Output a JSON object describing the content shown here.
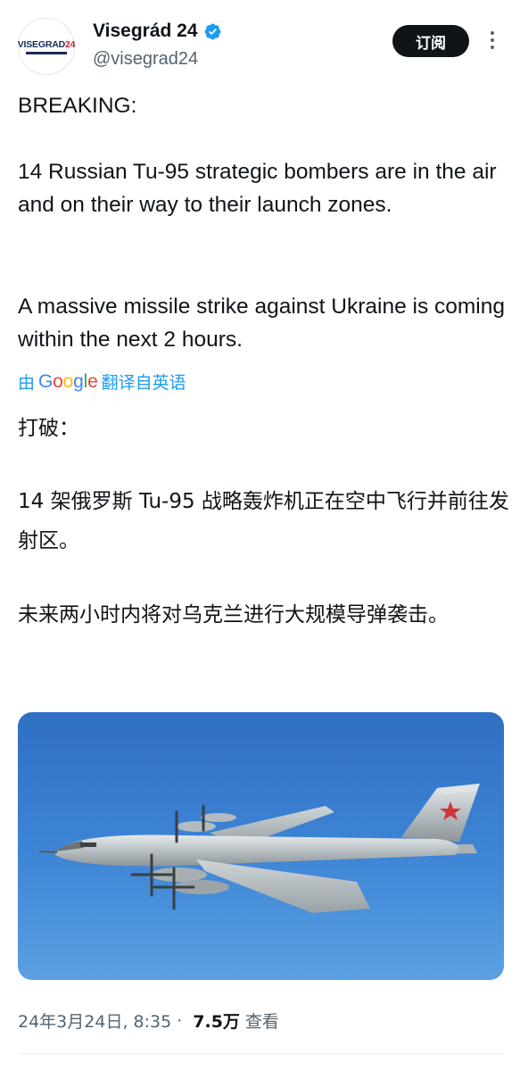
{
  "author": {
    "display_name": "Visegrád 24",
    "handle": "@visegrad24",
    "avatar_logo": [
      "VISEGRAD",
      "24"
    ]
  },
  "actions": {
    "subscribe_label": "订阅"
  },
  "tweet": {
    "line_breaking": "BREAKING:",
    "line_1": "14 Russian Tu-95 strategic bombers are in the air and on their way to their launch zones.",
    "line_2": "A massive missile strike against Ukraine is coming within the next 2 hours."
  },
  "translation": {
    "prefix": "由",
    "brand": "Google",
    "suffix": "翻译自英语",
    "line_breaking": "打破：",
    "line_1": "14 架俄罗斯 Tu-95 战略轰炸机正在空中飞行并前往发射区。",
    "line_2": "未来两小时内将对乌克兰进行大规模导弹袭击。"
  },
  "meta": {
    "date": "24年3月24日, 8:35",
    "separator": "·",
    "views": "7.5万",
    "views_label": "查看"
  },
  "colors": {
    "link_blue": "#1d9bf0",
    "verified_blue": "#1d9bf0",
    "text_primary": "#0f1419",
    "text_secondary": "#536471",
    "sky": "#3a7fd0"
  },
  "icons": {
    "verified": "verified-badge-icon",
    "more": "more-dots-icon"
  }
}
